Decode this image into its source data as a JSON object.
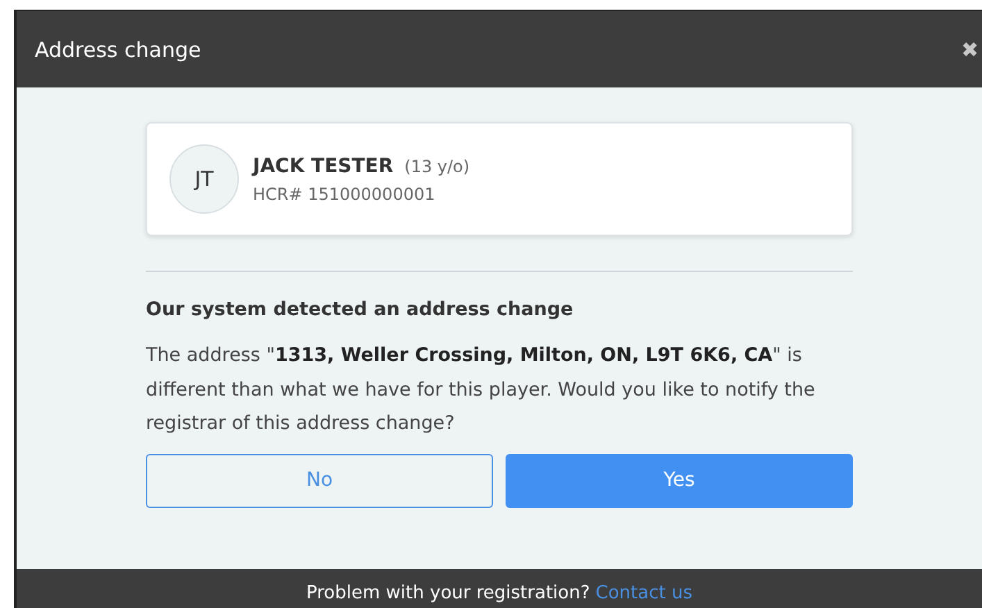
{
  "dialog": {
    "title": "Address change",
    "close": "✖"
  },
  "player": {
    "initials": "JT",
    "name": "JACK TESTER",
    "age": "(13 y/o)",
    "hcr": "HCR# 151000000001"
  },
  "heading": "Our system detected an address change",
  "message": "The address \"**1313, Weller Crossing, Milton, ON, L9T 6K6, CA**\" is different than what we have for this player. Would you like to notify the registrar of this address change?",
  "buttons": [
    {
      "label": "No",
      "kind": "secondary"
    },
    {
      "label": "Yes",
      "kind": "primary"
    }
  ],
  "footer": {
    "text": "Problem with your registration?",
    "link": "Contact us"
  }
}
